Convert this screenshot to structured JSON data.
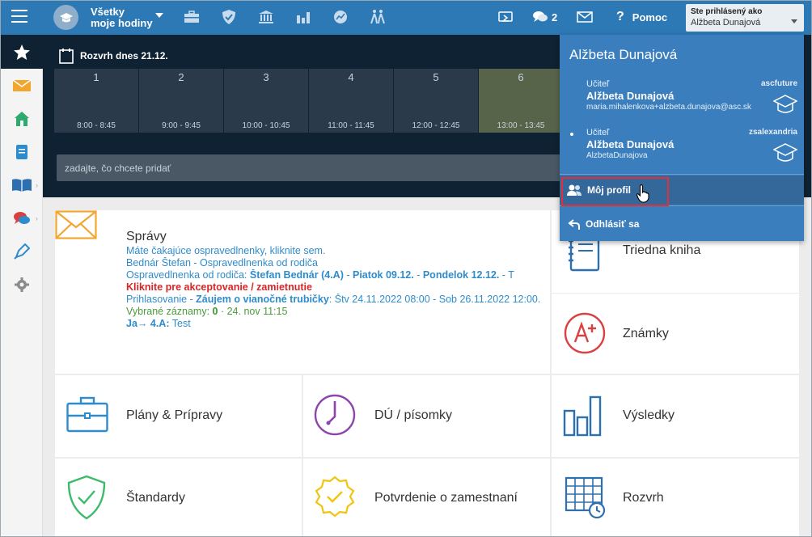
{
  "header": {
    "brand_line1": "Všetky",
    "brand_line2": "moje hodiny",
    "messages_count": "2",
    "help_label": "Pomoc",
    "login_label": "Ste prihlásený ako",
    "login_user": "Alžbeta Dunajová"
  },
  "schedule": {
    "title": "Rozvrh dnes 21.12.",
    "periods": [
      {
        "num": "1",
        "time": "8:00 - 8:45"
      },
      {
        "num": "2",
        "time": "9:00 - 9:45"
      },
      {
        "num": "3",
        "time": "10:00 - 10:45"
      },
      {
        "num": "4",
        "time": "11:00 - 11:45"
      },
      {
        "num": "5",
        "time": "12:00 - 12:45"
      },
      {
        "num": "6",
        "time": "13:00 - 13:45"
      }
    ],
    "input_placeholder": "zadajte, čo chcete pridať"
  },
  "messages": {
    "title": "Správy",
    "line1": "Máte čakajúce ospravedlnenky, kliknite sem.",
    "line2": "Bednár Štefan - Ospravedlnenka od rodiča",
    "l3_a": "Ospravedlnenka od rodiča: ",
    "l3_b": "Štefan Bednár (4.A)",
    "l3_c": " - ",
    "l3_d": "Piatok 09.12.",
    "l3_e": " - ",
    "l3_f": "Pondelok 12.12.",
    "l3_g": " - T",
    "line4": "Kliknite pre akceptovanie / zamietnutie",
    "l5_a": "Prihlasovanie - ",
    "l5_b": "Záujem o vianočné trubičky",
    "l5_c": ": Štv 24.11.2022 08:00 - Sob 26.11.2022 12:00.",
    "l6_a": "Vybrané záznamy: ",
    "l6_b": "0",
    "l6_c": " · 24. nov 11:15",
    "l7_a": "Ja→ 4.A:",
    "l7_b": " Test"
  },
  "tiles": {
    "triedna_kniha": "Triedna kniha",
    "znamky": "Známky",
    "plany": "Plány & Prípravy",
    "du": "DÚ / písomky",
    "vysledky": "Výsledky",
    "standardy": "Štandardy",
    "potvrdenie": "Potvrdenie o zamestnaní",
    "rozvrh": "Rozvrh"
  },
  "dropdown": {
    "heading": "Alžbeta Dunajová",
    "accounts": [
      {
        "role": "Učiteľ",
        "name": "Alžbeta Dunajová",
        "email": "maria.mihalenkova+alzbeta.dunajova@asc.sk",
        "school": "ascfuture"
      },
      {
        "role": "Učiteľ",
        "name": "Alžbeta Dunajová",
        "email": "AlzbetaDunajova",
        "school": "zsalexandria"
      }
    ],
    "profile_label": "Môj profil",
    "logout_label": "Odhlásiť sa"
  },
  "colors": {
    "topbar": "#2c79b5",
    "dark_panel": "#0f2233",
    "dropdown": "#3a7ebd",
    "highlight": "#e0313b",
    "link": "#2e8ccc"
  },
  "icons": {
    "menu": "hamburger-icon",
    "briefcase": "briefcase-icon",
    "shield": "shield-icon",
    "institution": "bank-icon",
    "stats": "bar-chart-icon",
    "chart": "chart-circle-icon",
    "walk": "walking-icon",
    "cast": "cast-icon",
    "chat": "chat-icon",
    "mail": "envelope-icon",
    "help": "question-icon"
  }
}
